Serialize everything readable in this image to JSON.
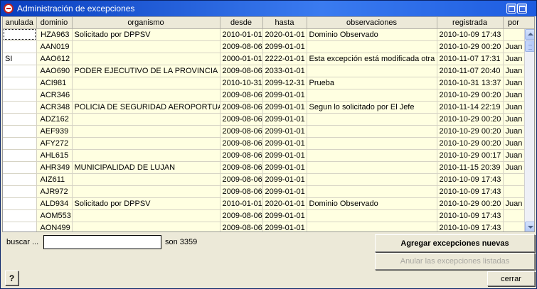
{
  "window": {
    "title": "Administración de excepciones"
  },
  "columns": [
    "anulada",
    "dominio",
    "organismo",
    "desde",
    "hasta",
    "observaciones",
    "registrada",
    "por"
  ],
  "rows": [
    {
      "anulada": "",
      "dominio": "HZA963",
      "organismo": "Solicitado por DPPSV",
      "desde": "2010-01-01",
      "hasta": "2020-01-01",
      "observaciones": "Dominio Observado",
      "registrada": "2010-10-09 17:43",
      "por": ""
    },
    {
      "anulada": "",
      "dominio": "AAN019",
      "organismo": "",
      "desde": "2009-08-06",
      "hasta": "2099-01-01",
      "observaciones": "",
      "registrada": "2010-10-29 00:20",
      "por": "Juan"
    },
    {
      "anulada": "SI",
      "dominio": "AAO612",
      "organismo": "",
      "desde": "2000-01-01",
      "hasta": "2222-01-01",
      "observaciones": "Esta excepción está modificada otra",
      "registrada": "2010-11-07 17:31",
      "por": "Juan"
    },
    {
      "anulada": "",
      "dominio": "AAO690",
      "organismo": "PODER EJECUTIVO DE LA PROVINCIA DE",
      "desde": "2009-08-06",
      "hasta": "2033-01-01",
      "observaciones": "",
      "registrada": "2010-11-07 20:40",
      "por": "Juan"
    },
    {
      "anulada": "",
      "dominio": "ACI981",
      "organismo": "",
      "desde": "2010-10-31",
      "hasta": "2099-12-31",
      "observaciones": "Prueba",
      "registrada": "2010-10-31 13:37",
      "por": "Juan"
    },
    {
      "anulada": "",
      "dominio": "ACR346",
      "organismo": "",
      "desde": "2009-08-06",
      "hasta": "2099-01-01",
      "observaciones": "",
      "registrada": "2010-10-29 00:20",
      "por": "Juan"
    },
    {
      "anulada": "",
      "dominio": "ACR348",
      "organismo": "POLICIA DE SEGURIDAD AEROPORTUARIA",
      "desde": "2009-08-06",
      "hasta": "2099-01-01",
      "observaciones": "Segun lo solicitado por El Jefe",
      "registrada": "2010-11-14 22:19",
      "por": "Juan"
    },
    {
      "anulada": "",
      "dominio": "ADZ162",
      "organismo": "",
      "desde": "2009-08-06",
      "hasta": "2099-01-01",
      "observaciones": "",
      "registrada": "2010-10-29 00:20",
      "por": "Juan"
    },
    {
      "anulada": "",
      "dominio": "AEF939",
      "organismo": "",
      "desde": "2009-08-06",
      "hasta": "2099-01-01",
      "observaciones": "",
      "registrada": "2010-10-29 00:20",
      "por": "Juan"
    },
    {
      "anulada": "",
      "dominio": "AFY272",
      "organismo": "",
      "desde": "2009-08-06",
      "hasta": "2099-01-01",
      "observaciones": "",
      "registrada": "2010-10-29 00:20",
      "por": "Juan"
    },
    {
      "anulada": "",
      "dominio": "AHL615",
      "organismo": "",
      "desde": "2009-08-06",
      "hasta": "2099-01-01",
      "observaciones": "",
      "registrada": "2010-10-29 00:17",
      "por": "Juan"
    },
    {
      "anulada": "",
      "dominio": "AHR349",
      "organismo": "MUNICIPALIDAD DE LUJAN",
      "desde": "2009-08-06",
      "hasta": "2099-01-01",
      "observaciones": "",
      "registrada": "2010-11-15 20:39",
      "por": "Juan"
    },
    {
      "anulada": "",
      "dominio": "AIZ611",
      "organismo": "",
      "desde": "2009-08-06",
      "hasta": "2099-01-01",
      "observaciones": "",
      "registrada": "2010-10-09 17:43",
      "por": ""
    },
    {
      "anulada": "",
      "dominio": "AJR972",
      "organismo": "",
      "desde": "2009-08-06",
      "hasta": "2099-01-01",
      "observaciones": "",
      "registrada": "2010-10-09 17:43",
      "por": ""
    },
    {
      "anulada": "",
      "dominio": "ALD934",
      "organismo": "Solicitado por DPPSV",
      "desde": "2010-01-01",
      "hasta": "2020-01-01",
      "observaciones": "Dominio Observado",
      "registrada": "2010-10-29 00:20",
      "por": "Juan"
    },
    {
      "anulada": "",
      "dominio": "AOM553",
      "organismo": "",
      "desde": "2009-08-06",
      "hasta": "2099-01-01",
      "observaciones": "",
      "registrada": "2010-10-09 17:43",
      "por": ""
    },
    {
      "anulada": "",
      "dominio": "AON499",
      "organismo": "",
      "desde": "2009-08-06",
      "hasta": "2099-01-01",
      "observaciones": "",
      "registrada": "2010-10-09 17:43",
      "por": ""
    }
  ],
  "search": {
    "label": "buscar ...",
    "value": ""
  },
  "count_text": "son 3359",
  "buttons": {
    "add": "Agregar excepciones nuevas",
    "annul": "Anular las excepciones listadas",
    "close": "cerrar",
    "help": "?"
  },
  "icons": {
    "app": "no-entry-icon",
    "restore": "restore-window-icon",
    "close": "close-window-icon"
  }
}
